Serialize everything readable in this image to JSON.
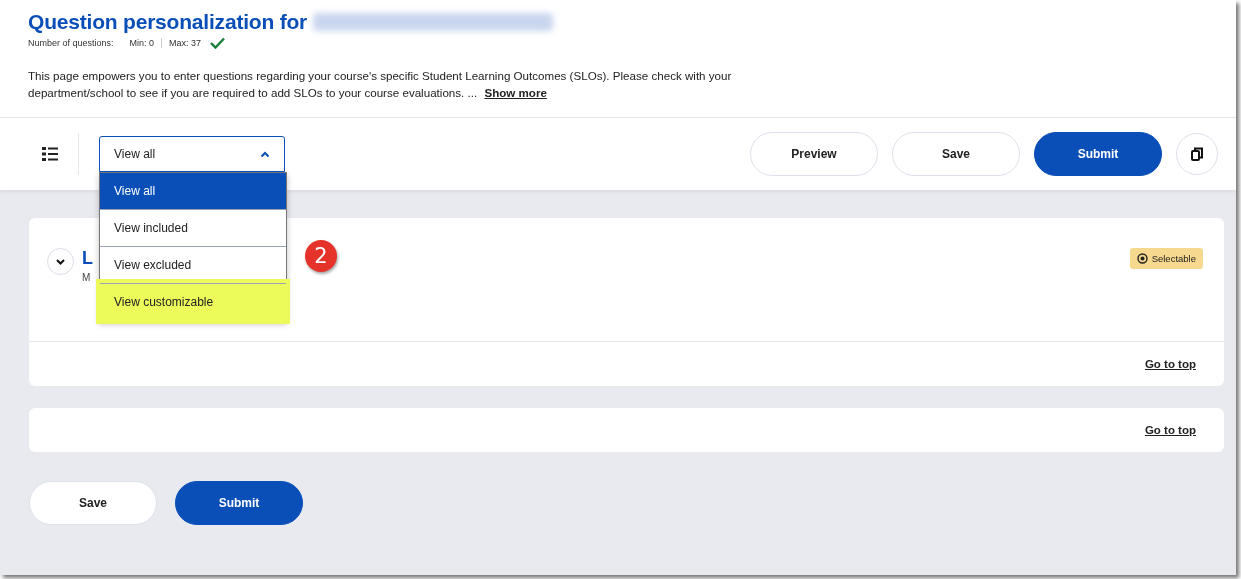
{
  "header": {
    "title": "Question personalization for",
    "redacted_name": true,
    "counts": {
      "label": "Number of questions:",
      "min": "Min: 0",
      "max": "Max: 37",
      "valid": true
    },
    "description": "This page empowers you to enter questions regarding your course's specific Student Learning Outcomes (SLOs). Please check with your department/school to see if you are required to add SLOs to your course evaluations. ...",
    "show_more": "Show more"
  },
  "toolbar": {
    "filter": {
      "value": "View all",
      "expanded": true,
      "options": [
        {
          "label": "View all",
          "selected": true,
          "highlighted": false
        },
        {
          "label": "View included",
          "selected": false,
          "highlighted": false
        },
        {
          "label": "View excluded",
          "selected": false,
          "highlighted": false
        },
        {
          "label": "View customizable",
          "selected": false,
          "highlighted": true
        }
      ]
    },
    "buttons": [
      {
        "label": "Preview",
        "kind": "secondary"
      },
      {
        "label": "Save",
        "kind": "secondary"
      },
      {
        "label": "Submit",
        "kind": "primary"
      }
    ]
  },
  "callout": {
    "number": "2"
  },
  "sections": [
    {
      "title": "L",
      "subtitle": "M",
      "badge": "Selectable",
      "expanded": false,
      "go_to_top": "Go to top"
    },
    {
      "go_to_top": "Go to top"
    }
  ],
  "footer_buttons": [
    {
      "label": "Save",
      "kind": "secondary"
    },
    {
      "label": "Submit",
      "kind": "primary"
    }
  ]
}
